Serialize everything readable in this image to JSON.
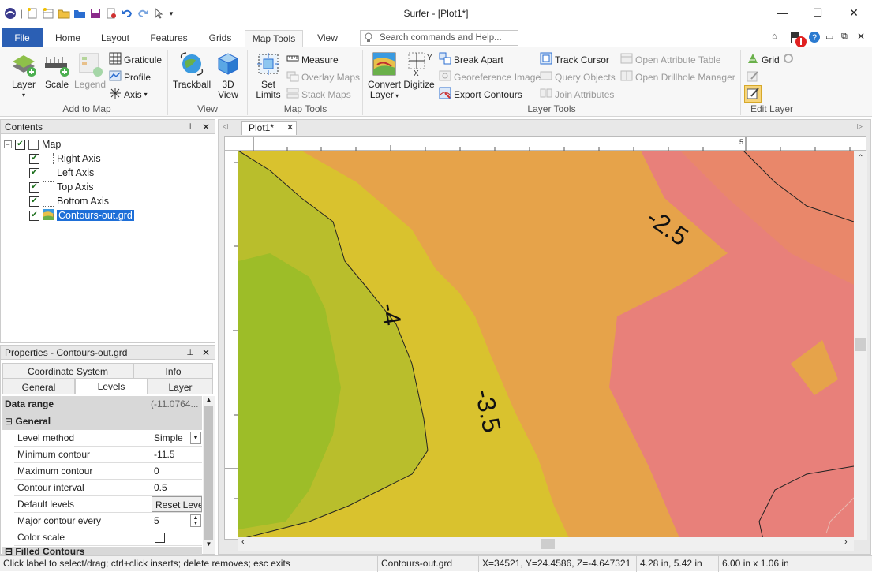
{
  "app": {
    "title": "Surfer - [Plot1*]"
  },
  "window_buttons": {
    "minimize": "—",
    "maximize": "☐",
    "close": "✕"
  },
  "tabs": [
    "File",
    "Home",
    "Layout",
    "Features",
    "Grids",
    "Map Tools",
    "View"
  ],
  "active_tab": "Map Tools",
  "search": {
    "placeholder": "Search commands and Help..."
  },
  "ribbon": {
    "add_to_map": {
      "label": "Add to Map",
      "layer": "Layer",
      "scale": "Scale",
      "legend": "Legend",
      "graticule": "Graticule",
      "profile": "Profile",
      "axis": "Axis"
    },
    "view": {
      "label": "View",
      "trackball": "Trackball",
      "view3d_line1": "3D",
      "view3d_line2": "View"
    },
    "map_tools": {
      "label": "Map Tools",
      "set_limits_line1": "Set",
      "set_limits_line2": "Limits",
      "measure": "Measure",
      "overlay_maps": "Overlay Maps",
      "stack_maps": "Stack Maps"
    },
    "layer_tools": {
      "label": "Layer Tools",
      "convert_line1": "Convert",
      "convert_line2": "Layer",
      "digitize": "Digitize",
      "break_apart": "Break Apart",
      "georeference": "Georeference Image",
      "export_contours": "Export Contours",
      "track_cursor": "Track Cursor",
      "query_objects": "Query Objects",
      "join_attributes": "Join Attributes",
      "open_attribute_table": "Open Attribute Table",
      "open_drillhole_manager": "Open Drillhole Manager"
    },
    "edit_layer": {
      "label": "Edit Layer",
      "grid": "Grid"
    }
  },
  "contents_panel": {
    "title": "Contents",
    "items": [
      {
        "label": "Map",
        "checked": true
      },
      {
        "label": "Right Axis",
        "checked": true
      },
      {
        "label": "Left Axis",
        "checked": true
      },
      {
        "label": "Top Axis",
        "checked": true
      },
      {
        "label": "Bottom Axis",
        "checked": true
      },
      {
        "label": "Contours-out.grd",
        "checked": true,
        "selected": true
      }
    ]
  },
  "properties_panel": {
    "title": "Properties - Contours-out.grd",
    "tabs_row1": [
      "Coordinate System",
      "Info"
    ],
    "tabs_row2": [
      "General",
      "Levels",
      "Layer"
    ],
    "active_tab": "Levels",
    "data_range_label": "Data range",
    "data_range_value": "(-11.0764...",
    "section_general": "General",
    "rows": [
      {
        "key": "Level method",
        "value": "Simple"
      },
      {
        "key": "Minimum contour",
        "value": "-11.5"
      },
      {
        "key": "Maximum contour",
        "value": "0"
      },
      {
        "key": "Contour interval",
        "value": "0.5"
      },
      {
        "key": "Default levels",
        "value": "Reset Levels"
      },
      {
        "key": "Major contour every",
        "value": "5"
      },
      {
        "key": "Color scale",
        "value": ""
      }
    ],
    "section_filled": "Filled Contours"
  },
  "document": {
    "tab": "Plot1*",
    "ruler_mark": "5",
    "contour_labels": [
      "-2.5",
      "-4",
      "-3.5"
    ]
  },
  "status": {
    "hint": "Click label to select/drag; ctrl+click inserts; delete removes; esc exits",
    "layer": "Contours-out.grd",
    "coords": "X=34521, Y=24.4586, Z=-4.647321",
    "position": "4.28 in, 5.42 in",
    "size": "6.00 in x 1.06 in"
  },
  "colors": {
    "file_tab": "#2b5fb4",
    "contour_green": "#9dbd28",
    "contour_yellow": "#d9c22e",
    "contour_orange": "#e6a34a",
    "contour_salmon": "#e9876a",
    "contour_pink": "#e8807a"
  }
}
